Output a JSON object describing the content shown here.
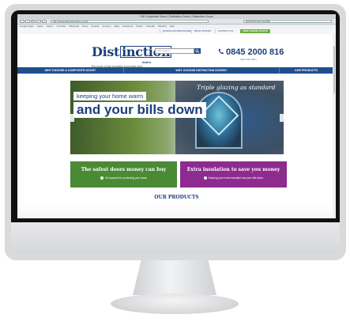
{
  "browser": {
    "window_title": "DW Composite Doors | Distinction Doors | Distinction Doors",
    "url": "http://www.distinctiondoors.co.uk/",
    "search_value": "DISTINCTION DOORS",
    "bookmarks": [
      "Google Maps",
      "Apple",
      "Yahoo!",
      "YouTube",
      "Wikipedia",
      "News",
      "Popular",
      "Amazon",
      "eBay",
      "Facebook",
      "Twitter",
      "LinkedIn",
      "Weather",
      "Mail"
    ]
  },
  "site": {
    "top_links": [
      "DOWNLOAD BROCHURE",
      "BOOK SURVEY",
      "CONTACT US"
    ],
    "quote_button": "FREE ONLINE QUOTE",
    "logo_main_1": "Dist",
    "logo_box": "inction",
    "logo_doors": "doors",
    "tagline": "The home of the insulated composite door",
    "search_placeholder": "Site Search...",
    "phone": "0845 2000 816",
    "hours": "Open 8am-8pm",
    "nav": [
      "WHY CHOOSE A COMPOSITE DOOR?",
      "WHY CHOOSE DISTINCTION DOORS?",
      "OUR PRODUCTS"
    ]
  },
  "hero": {
    "script": "Triple glazing as standard",
    "line1": "keeping your home warm",
    "line2": "and your bills down"
  },
  "cta": [
    {
      "title": "The safest doors money can buy",
      "sub": "All important for protecting your home",
      "color": "#4a8a35"
    },
    {
      "title": "Extra insulation to save you money",
      "sub": "Keeping your home insulated and your bills down",
      "color": "#8e2b8f"
    }
  ],
  "section_title": "OUR PRODUCTS",
  "colors": {
    "brand_blue": "#1b3f7a",
    "nav_blue": "#1f4f8f",
    "quote_green": "#6cae3a"
  }
}
